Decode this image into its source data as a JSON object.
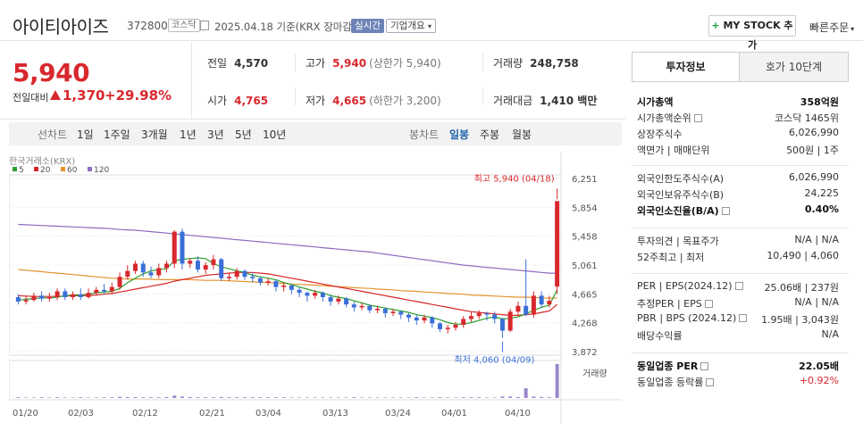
{
  "header": {
    "name": "아이티아이즈",
    "code": "372800",
    "market": "코스닥",
    "date_text": "2025.04.18 기준(KRX 장마감)",
    "realtime": "실시간",
    "corp_overview": "기업개요",
    "mystock": "MY STOCK 추가",
    "quick_order": "빠른주문"
  },
  "price": {
    "current": "5,940",
    "change_label": "전일대비",
    "change": "1,370",
    "change_pct": "+29.98%",
    "prev_label": "전일",
    "prev": "4,570",
    "high_label": "고가",
    "high": "5,940",
    "high_sub": "(상한가 5,940)",
    "volume_label": "거래량",
    "volume": "248,758",
    "open_label": "시가",
    "open": "4,765",
    "low_label": "저가",
    "low": "4,665",
    "low_sub": "(하한가 3,200)",
    "amount_label": "거래대금",
    "amount": "1,410 백만"
  },
  "period": {
    "label": "선차트",
    "items": [
      "1일",
      "1주일",
      "3개월",
      "1년",
      "3년",
      "5년",
      "10년"
    ],
    "candle_label": "봉차트",
    "candle_items": [
      "일봉",
      "주봉",
      "월봉"
    ],
    "candle_selected": "일봉"
  },
  "chart_data": {
    "type": "candlestick",
    "source": "한국거래소(KRX)",
    "legend": [
      {
        "name": "5",
        "color": "#2ca02c"
      },
      {
        "name": "20",
        "color": "#d62728"
      },
      {
        "name": "60",
        "color": "#e5932e"
      },
      {
        "name": "120",
        "color": "#8e6bbf"
      }
    ],
    "y_ticks": [
      6251,
      5854,
      5458,
      5061,
      4665,
      4268,
      3872
    ],
    "y_tick_labels": [
      "6,251",
      "5,854",
      "5,458",
      "5,061",
      "4,665",
      "4,268",
      "3,872"
    ],
    "ylim": [
      3872,
      6251
    ],
    "x_labels": [
      "01/20",
      "02/03",
      "02/12",
      "02/21",
      "03/04",
      "03/13",
      "03/24",
      "04/01",
      "04/10"
    ],
    "high_annotation": "최고 5,940 (04/18)",
    "low_annotation": "최저 4,060 (04/09)",
    "volume_label": "거래량",
    "candles": [
      [
        4620,
        4560,
        4660,
        4520
      ],
      [
        4560,
        4580,
        4640,
        4520
      ],
      [
        4580,
        4640,
        4680,
        4560
      ],
      [
        4640,
        4600,
        4700,
        4560
      ],
      [
        4600,
        4620,
        4680,
        4560
      ],
      [
        4620,
        4700,
        4740,
        4580
      ],
      [
        4700,
        4620,
        4740,
        4580
      ],
      [
        4620,
        4660,
        4700,
        4580
      ],
      [
        4660,
        4620,
        4740,
        4580
      ],
      [
        4620,
        4680,
        4740,
        4600
      ],
      [
        4680,
        4720,
        4760,
        4640
      ],
      [
        4720,
        4700,
        4800,
        4660
      ],
      [
        4700,
        4760,
        4820,
        4660
      ],
      [
        4760,
        4900,
        4960,
        4720
      ],
      [
        4900,
        4980,
        5060,
        4860
      ],
      [
        4980,
        5080,
        5120,
        4940
      ],
      [
        5080,
        4960,
        5120,
        4900
      ],
      [
        4960,
        4920,
        5040,
        4880
      ],
      [
        4920,
        5020,
        5080,
        4880
      ],
      [
        5020,
        5080,
        5120,
        4960
      ],
      [
        5080,
        5520,
        5540,
        5020
      ],
      [
        5520,
        5080,
        5560,
        5000
      ],
      [
        5080,
        5120,
        5160,
        5020
      ],
      [
        5120,
        5000,
        5180,
        4960
      ],
      [
        5000,
        5060,
        5100,
        4940
      ],
      [
        5060,
        5140,
        5200,
        5000
      ],
      [
        5140,
        4880,
        5160,
        4840
      ],
      [
        4880,
        4900,
        4960,
        4840
      ],
      [
        4900,
        4980,
        5020,
        4860
      ],
      [
        4980,
        4900,
        5000,
        4860
      ],
      [
        4900,
        4880,
        4960,
        4820
      ],
      [
        4880,
        4820,
        4900,
        4780
      ],
      [
        4820,
        4840,
        4880,
        4780
      ],
      [
        4840,
        4760,
        4860,
        4700
      ],
      [
        4760,
        4780,
        4820,
        4700
      ],
      [
        4780,
        4720,
        4800,
        4660
      ],
      [
        4720,
        4680,
        4760,
        4620
      ],
      [
        4680,
        4640,
        4700,
        4560
      ],
      [
        4640,
        4680,
        4720,
        4600
      ],
      [
        4680,
        4620,
        4700,
        4560
      ],
      [
        4620,
        4560,
        4660,
        4500
      ],
      [
        4560,
        4600,
        4640,
        4520
      ],
      [
        4600,
        4520,
        4620,
        4480
      ],
      [
        4520,
        4480,
        4560,
        4420
      ],
      [
        4480,
        4500,
        4540,
        4440
      ],
      [
        4500,
        4440,
        4520,
        4400
      ],
      [
        4440,
        4460,
        4500,
        4400
      ],
      [
        4460,
        4400,
        4480,
        4340
      ],
      [
        4400,
        4420,
        4460,
        4360
      ],
      [
        4420,
        4380,
        4440,
        4320
      ],
      [
        4380,
        4340,
        4400,
        4280
      ],
      [
        4340,
        4300,
        4380,
        4240
      ],
      [
        4300,
        4340,
        4380,
        4260
      ],
      [
        4340,
        4260,
        4360,
        4200
      ],
      [
        4260,
        4180,
        4280,
        4140
      ],
      [
        4180,
        4200,
        4240,
        4120
      ],
      [
        4200,
        4240,
        4280,
        4160
      ],
      [
        4240,
        4320,
        4360,
        4200
      ],
      [
        4320,
        4360,
        4420,
        4280
      ],
      [
        4360,
        4400,
        4440,
        4320
      ],
      [
        4400,
        4380,
        4420,
        4300
      ],
      [
        4380,
        4320,
        4420,
        4260
      ],
      [
        4320,
        4160,
        4340,
        4060
      ],
      [
        4160,
        4420,
        4460,
        4140
      ],
      [
        4420,
        4500,
        4560,
        4380
      ],
      [
        4500,
        4380,
        5140,
        4360
      ],
      [
        4380,
        4640,
        4700,
        4340
      ],
      [
        4640,
        4520,
        4700,
        4480
      ],
      [
        4520,
        4570,
        4640,
        4480
      ],
      [
        4765,
        5940,
        5940,
        4665
      ]
    ],
    "volumes": [
      3,
      2,
      2,
      3,
      2,
      3,
      2,
      2,
      3,
      2,
      2,
      3,
      3,
      5,
      4,
      4,
      3,
      3,
      3,
      4,
      10,
      6,
      4,
      3,
      3,
      3,
      4,
      3,
      3,
      3,
      3,
      3,
      3,
      3,
      3,
      2,
      2,
      2,
      2,
      2,
      2,
      2,
      2,
      3,
      2,
      2,
      2,
      2,
      2,
      2,
      2,
      3,
      2,
      2,
      3,
      2,
      2,
      3,
      3,
      3,
      2,
      2,
      6,
      6,
      4,
      40,
      6,
      4,
      3,
      140
    ],
    "ma5": [
      4580,
      4590,
      4600,
      4610,
      4610,
      4620,
      4640,
      4650,
      4650,
      4660,
      4680,
      4690,
      4700,
      4740,
      4820,
      4880,
      4940,
      4980,
      5000,
      5010,
      5120,
      5140,
      5150,
      5160,
      5150,
      5080,
      5040,
      5010,
      4980,
      4960,
      4920,
      4900,
      4880,
      4860,
      4820,
      4790,
      4760,
      4730,
      4700,
      4680,
      4640,
      4620,
      4600,
      4570,
      4540,
      4510,
      4490,
      4470,
      4450,
      4430,
      4410,
      4380,
      4360,
      4340,
      4310,
      4270,
      4250,
      4250,
      4270,
      4300,
      4330,
      4350,
      4320,
      4330,
      4350,
      4390,
      4440,
      4480,
      4510,
      4720
    ],
    "ma20": [
      4640,
      4635,
      4630,
      4630,
      4630,
      4630,
      4635,
      4640,
      4640,
      4645,
      4650,
      4660,
      4670,
      4690,
      4710,
      4730,
      4750,
      4770,
      4790,
      4810,
      4840,
      4860,
      4880,
      4900,
      4920,
      4930,
      4940,
      4950,
      4960,
      4960,
      4960,
      4950,
      4940,
      4920,
      4900,
      4880,
      4860,
      4840,
      4820,
      4800,
      4780,
      4760,
      4740,
      4720,
      4700,
      4680,
      4660,
      4640,
      4620,
      4600,
      4580,
      4560,
      4540,
      4520,
      4500,
      4480,
      4460,
      4440,
      4420,
      4410,
      4400,
      4390,
      4380,
      4370,
      4370,
      4380,
      4390,
      4410,
      4430,
      4520
    ],
    "ma60": [
      5000,
      4990,
      4980,
      4970,
      4960,
      4950,
      4940,
      4930,
      4920,
      4910,
      4900,
      4890,
      4880,
      4875,
      4870,
      4870,
      4870,
      4865,
      4860,
      4860,
      4860,
      4860,
      4860,
      4855,
      4850,
      4850,
      4850,
      4845,
      4840,
      4835,
      4830,
      4825,
      4820,
      4815,
      4810,
      4800,
      4795,
      4790,
      4785,
      4780,
      4770,
      4765,
      4760,
      4750,
      4745,
      4740,
      4730,
      4725,
      4720,
      4710,
      4705,
      4700,
      4690,
      4685,
      4680,
      4670,
      4665,
      4660,
      4650,
      4645,
      4640,
      4635,
      4630,
      4625,
      4620,
      4620,
      4615,
      4610,
      4605,
      4610
    ],
    "ma120": [
      5620,
      5615,
      5610,
      5605,
      5600,
      5595,
      5590,
      5585,
      5580,
      5575,
      5570,
      5565,
      5560,
      5550,
      5545,
      5540,
      5530,
      5520,
      5510,
      5500,
      5490,
      5480,
      5470,
      5460,
      5450,
      5440,
      5430,
      5420,
      5410,
      5400,
      5390,
      5380,
      5370,
      5360,
      5350,
      5340,
      5330,
      5320,
      5310,
      5300,
      5290,
      5280,
      5270,
      5260,
      5250,
      5240,
      5225,
      5210,
      5195,
      5180,
      5165,
      5150,
      5135,
      5120,
      5105,
      5090,
      5075,
      5060,
      5050,
      5040,
      5030,
      5020,
      5010,
      5000,
      4990,
      4980,
      4970,
      4960,
      4950,
      4950
    ]
  },
  "right_panel": {
    "tab_invest": "투자정보",
    "tab_hoga": "호가 10단계",
    "rows1": [
      {
        "l": "시가총액",
        "r": "358억원",
        "bold": true
      },
      {
        "l": "시가총액순위",
        "r": "코스닥 1465위"
      },
      {
        "l": "상장주식수",
        "r": "6,026,990"
      },
      {
        "l": "액면가 | 매매단위",
        "r": "500원 | 1주"
      }
    ],
    "rows2": [
      {
        "l": "외국인한도주식수(A)",
        "r": "6,026,990"
      },
      {
        "l": "외국인보유주식수(B)",
        "r": "24,225"
      },
      {
        "l": "외국인소진율(B/A)",
        "r": "0.40%",
        "bold": true
      }
    ],
    "rows3": [
      {
        "l": "투자의견 | 목표주가",
        "r": "N/A | N/A"
      },
      {
        "l": "52주최고 | 최저",
        "r": "10,490 | 4,060"
      }
    ],
    "rows4": [
      {
        "l": "PER | EPS(2024.12)",
        "r": "25.06배 | 237원"
      },
      {
        "l": "추정PER | EPS",
        "r": "N/A | N/A"
      },
      {
        "l": "PBR | BPS (2024.12)",
        "r": "1.95배 | 3,043원"
      },
      {
        "l": "배당수익률",
        "r": "N/A"
      }
    ],
    "rows5": [
      {
        "l": "동일업종 PER",
        "r": "22.05배",
        "bold": true
      },
      {
        "l": "동일업종 등락률",
        "r": "+0.92%",
        "red": true
      }
    ]
  }
}
